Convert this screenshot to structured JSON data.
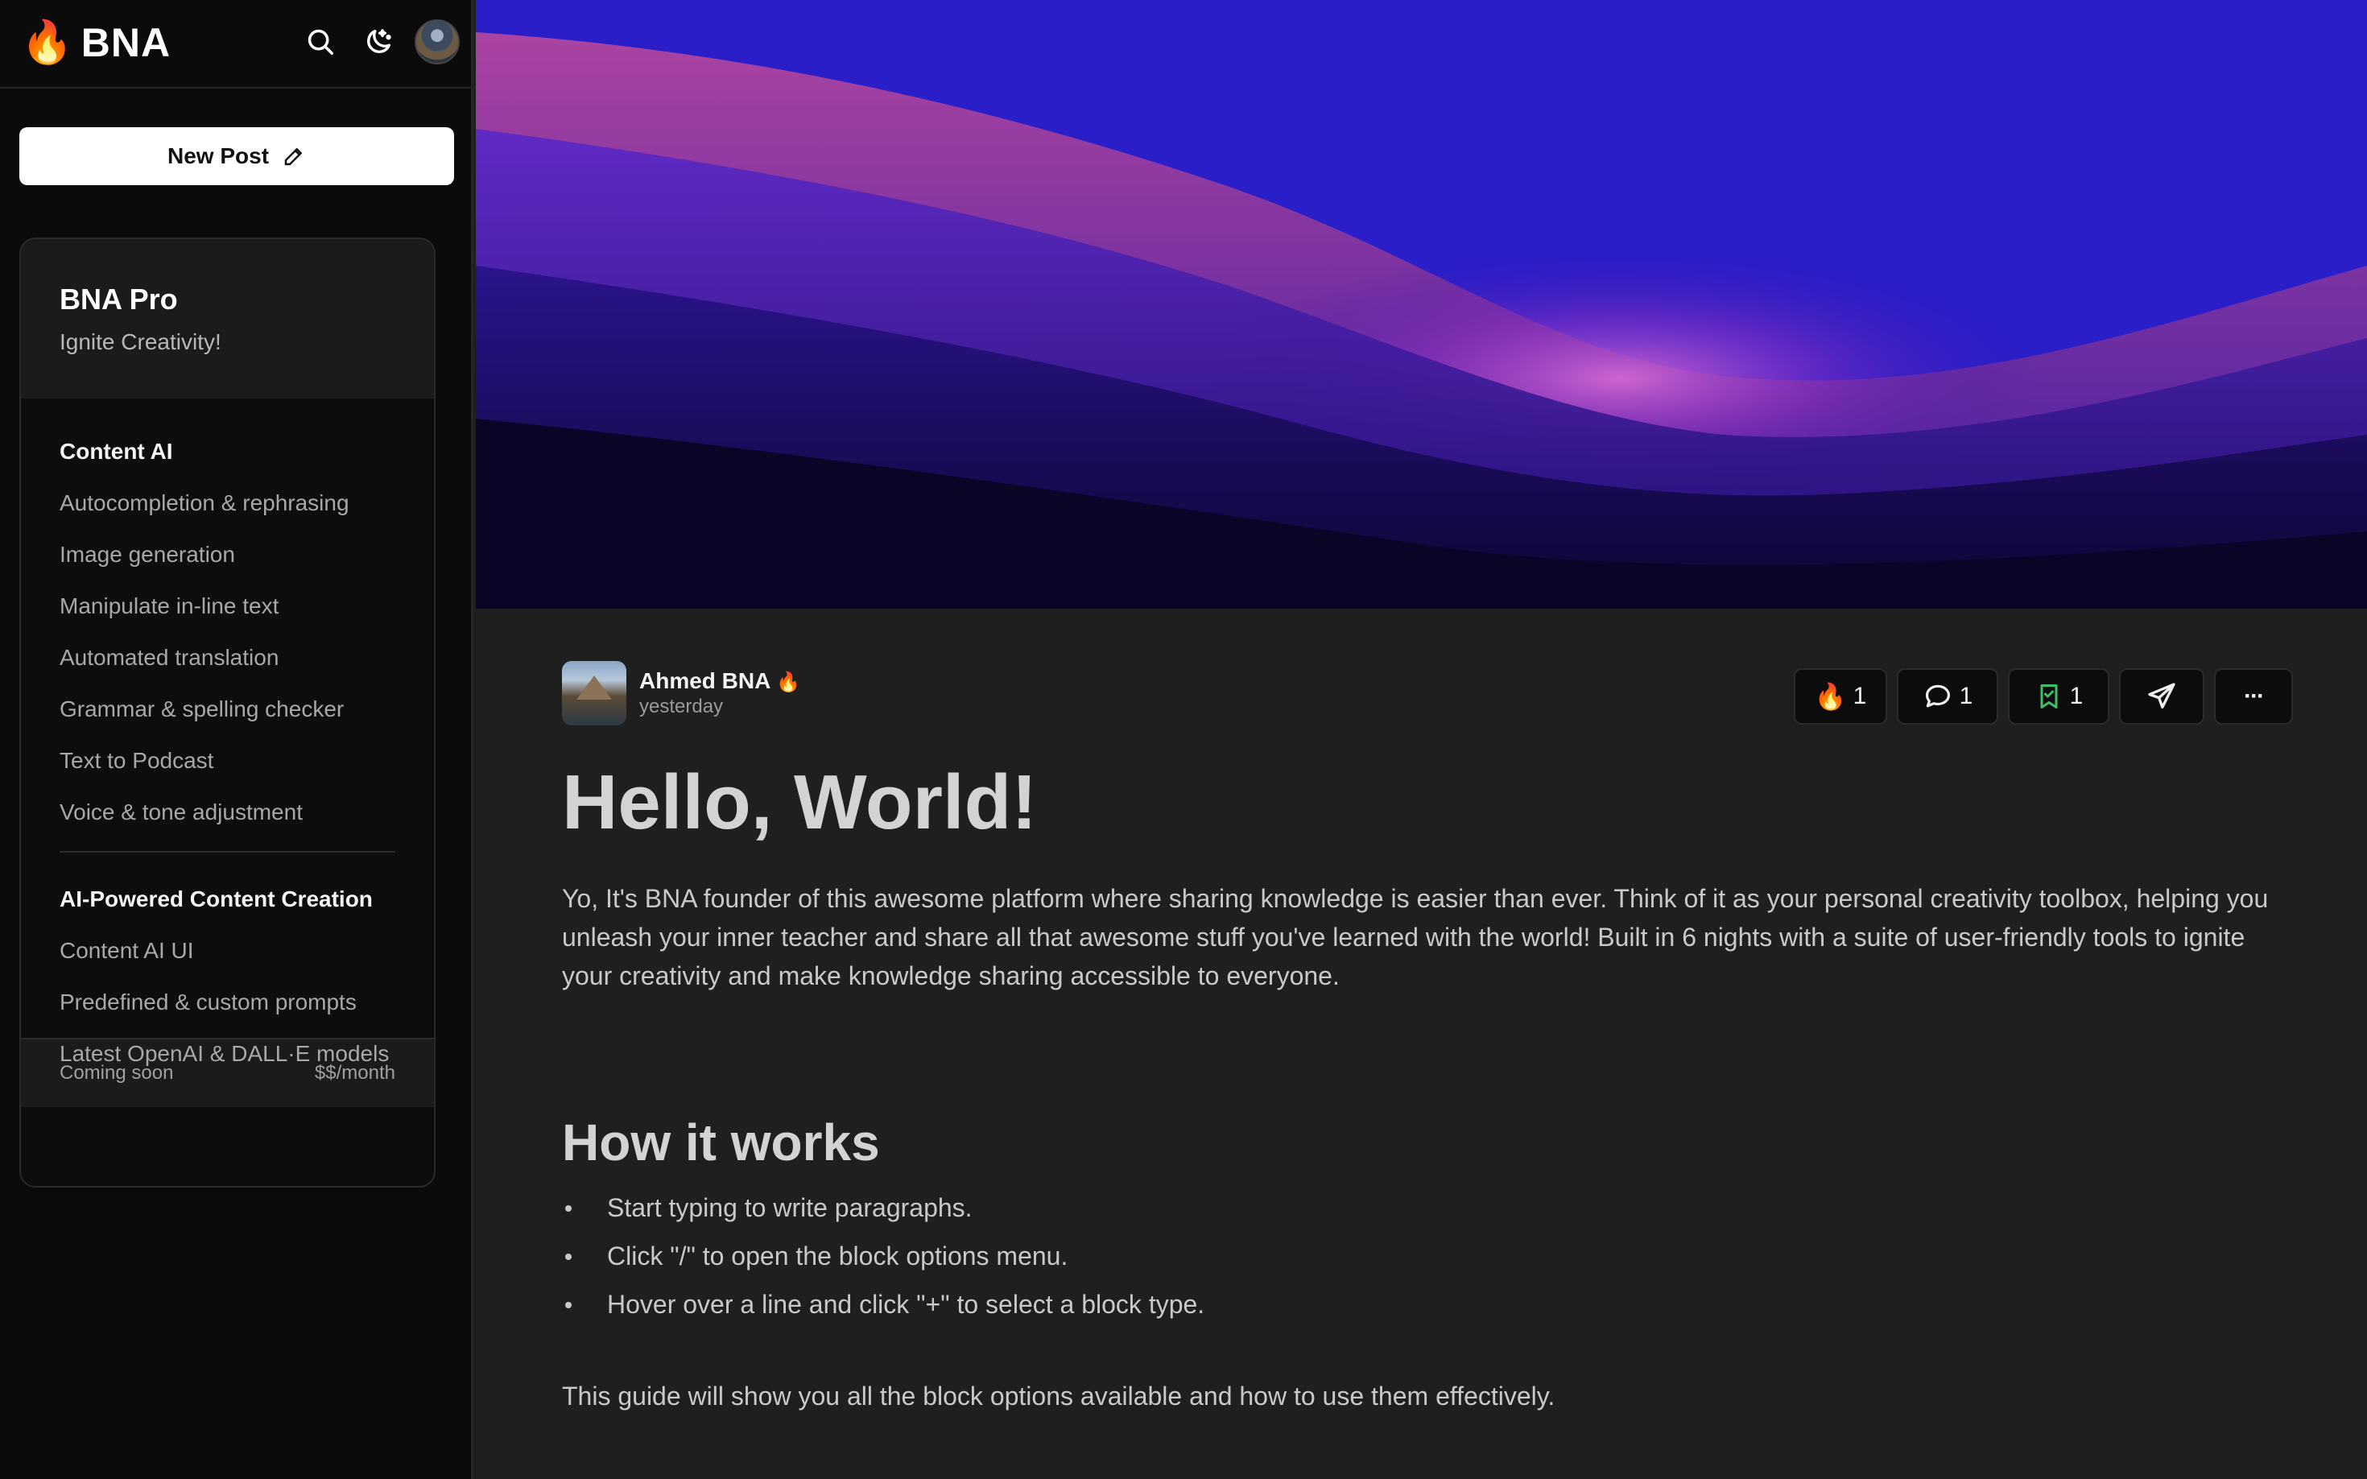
{
  "app": {
    "brand_name": "BNA",
    "logo_glyph": "🔥"
  },
  "sidebar": {
    "new_post_label": "New Post",
    "pro": {
      "title": "BNA Pro",
      "subtitle": "Ignite Creativity!",
      "sections": [
        {
          "title": "Content AI",
          "items": [
            "Autocompletion & rephrasing",
            "Image generation",
            "Manipulate in-line text",
            "Automated translation",
            "Grammar & spelling checker",
            "Text to Podcast",
            "Voice & tone adjustment"
          ]
        },
        {
          "title": "AI-Powered Content Creation",
          "items": [
            "Content AI UI",
            "Predefined & custom prompts",
            "Latest OpenAI & DALL·E models"
          ]
        }
      ],
      "footer_left": "Coming soon",
      "footer_right": "$$/month"
    }
  },
  "post": {
    "author_name": "Ahmed BNA",
    "author_badge": "🔥",
    "time": "yesterday",
    "actions": {
      "fire_glyph": "🔥",
      "fire_count": "1",
      "comment_count": "1",
      "bookmark_count": "1",
      "more_glyph": "···"
    },
    "title": "Hello, World!",
    "intro": "Yo, It's BNA founder of this awesome platform where sharing knowledge is easier than ever. Think of it as your personal creativity toolbox, helping you unleash your inner teacher and share all that awesome stuff you've learned with the world! Built in 6 nights with a suite of user-friendly tools to ignite your creativity and make knowledge sharing accessible to everyone.",
    "section_heading": "How it works",
    "bullets": [
      "Start typing to write paragraphs.",
      "Click \"/\" to open the block options menu.",
      "Hover over a line and click \"+\" to select a block type."
    ],
    "outro": "This guide will show you all the block options available and how to use them effectively."
  },
  "colors": {
    "sidebar_bg": "#0b0b0c",
    "main_bg": "#1f1f1f",
    "bookmark_green": "#3fbf6a",
    "cover_top": "#2c1fd6",
    "cover_bottom": "#0e0736"
  }
}
